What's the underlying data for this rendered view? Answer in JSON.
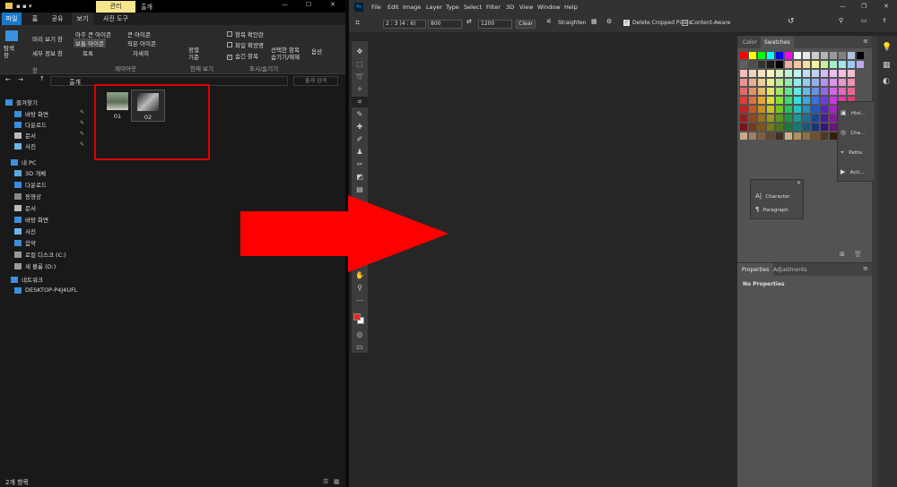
{
  "explorer": {
    "ribbon_context_tab": "관리",
    "folder_title": "출개",
    "tabs": [
      "파일",
      "홈",
      "공유",
      "보기",
      "사진 도구"
    ],
    "ribbon": {
      "nav_pane": "탐색\n창",
      "preview_pane": "미리 보기 창",
      "details_pane": "세부 정보 창",
      "layout": {
        "xl_icons": "아주 큰 아이콘",
        "l_icons": "큰 아이콘",
        "m_icons": "보통 아이콘",
        "s_icons": "작은 아이콘",
        "list": "목록",
        "details": "자세히"
      },
      "sort": "정렬\n기준",
      "checkbox_item": "항목 확인란",
      "file_ext": "파일 확장명",
      "hidden_items": "숨긴 항목",
      "hide_selected": "선택한 항목\n숨기기/해제",
      "options": "옵션",
      "group_pane": "창",
      "group_layout": "레이아웃",
      "group_current_view": "현재 보기",
      "group_show_hide": "표시/숨기기"
    },
    "address": "출개",
    "search_placeholder": "출개 검색",
    "nav": {
      "quick_access": "즐겨찾기",
      "qa_items": [
        "바탕 화면",
        "다운로드",
        "문서",
        "사진"
      ],
      "this_pc": "내 PC",
      "pc_items": [
        "3D 개체",
        "다운로드",
        "동영상",
        "문서",
        "바탕 화면",
        "사진",
        "음악",
        "로컬 디스크 (C:)",
        "새 볼륨 (D:)"
      ],
      "network": "네트워크",
      "network_items": [
        "DESKTOP-P4J4UFL"
      ]
    },
    "files": [
      "01",
      "02"
    ],
    "status": "2개 항목"
  },
  "photoshop": {
    "app_icon": "Ps",
    "menu": [
      "File",
      "Edit",
      "Image",
      "Layer",
      "Type",
      "Select",
      "Filter",
      "3D",
      "View",
      "Window",
      "Help"
    ],
    "options": {
      "ratio": "2 : 3 (4 : 6)",
      "width": "800",
      "height": "1200",
      "clear": "Clear",
      "straighten": "Straighten",
      "delete_cropped": "Delete Cropped Pixels",
      "content_aware": "Content-Aware"
    },
    "panels": {
      "color_tab": "Color",
      "swatches_tab": "Swatches",
      "properties_tab": "Properties",
      "adjustments_tab": "Adjustments",
      "no_properties": "No Properties",
      "history": "Hist...",
      "channels": "Cha...",
      "paths": "Paths",
      "actions": "Acti...",
      "character": "Character",
      "paragraph": "Paragraph"
    },
    "colors": {
      "foreground": "#e8261e",
      "background": "#ffffff"
    }
  },
  "annotation": {
    "arrow_color": "#ff0000",
    "highlight_color": "#e00000"
  }
}
